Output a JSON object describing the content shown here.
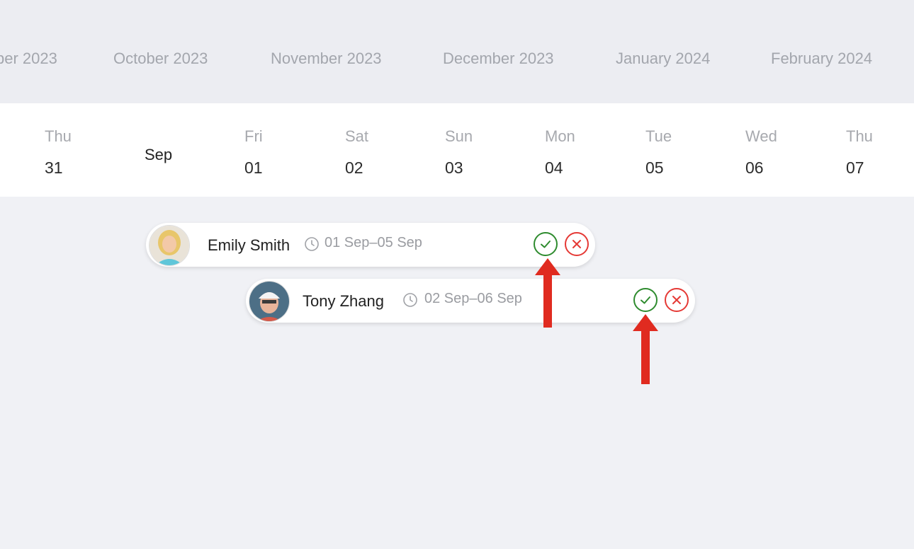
{
  "months": [
    "ber 2023",
    "October 2023",
    "November 2023",
    "December 2023",
    "January 2024",
    "February 2024"
  ],
  "month_marker": "Sep",
  "days": [
    {
      "dow": "Thu",
      "num": "31"
    },
    {
      "dow": "Fri",
      "num": "01"
    },
    {
      "dow": "Sat",
      "num": "02"
    },
    {
      "dow": "Sun",
      "num": "03"
    },
    {
      "dow": "Mon",
      "num": "04"
    },
    {
      "dow": "Tue",
      "num": "05"
    },
    {
      "dow": "Wed",
      "num": "06"
    },
    {
      "dow": "Thu",
      "num": "07"
    }
  ],
  "bookings": [
    {
      "name": "Emily Smith",
      "dates": "01 Sep–05 Sep",
      "avatar_icon": "avatar-blonde-woman",
      "actions": [
        "approve-icon",
        "decline-icon"
      ]
    },
    {
      "name": "Tony Zhang",
      "dates": "02 Sep–06 Sep",
      "avatar_icon": "avatar-man-with-cap",
      "actions": [
        "approve-icon",
        "decline-icon"
      ]
    }
  ],
  "colors": {
    "approve": "#2e8b2e",
    "decline": "#e53935",
    "annotation_arrow": "#e02b20"
  }
}
